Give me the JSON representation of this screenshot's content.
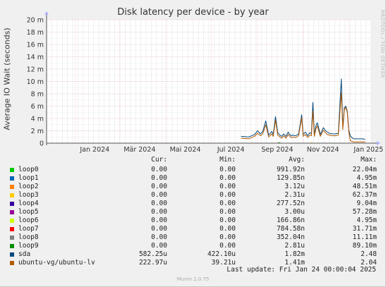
{
  "watermark": "RRDTOOL / TOBI OETIKER",
  "footer": "Munin 2.0.75",
  "last_update": "Last update: Fri Jan 24 00:00:04 2025",
  "legend_headers": {
    "cur": "Cur:",
    "min": "Min:",
    "avg": "Avg:",
    "max": "Max:"
  },
  "legend": [
    {
      "name": "loop0",
      "color": "#00cc00",
      "cur": "0.00",
      "min": "0.00",
      "avg": "991.92n",
      "max": "22.04m"
    },
    {
      "name": "loop1",
      "color": "#0066b3",
      "cur": "0.00",
      "min": "0.00",
      "avg": "129.85n",
      "max": "4.95m"
    },
    {
      "name": "loop2",
      "color": "#ff8000",
      "cur": "0.00",
      "min": "0.00",
      "avg": "3.12u",
      "max": "48.51m"
    },
    {
      "name": "loop3",
      "color": "#ffcc00",
      "cur": "0.00",
      "min": "0.00",
      "avg": "2.31u",
      "max": "62.37m"
    },
    {
      "name": "loop4",
      "color": "#330099",
      "cur": "0.00",
      "min": "0.00",
      "avg": "277.52n",
      "max": "9.04m"
    },
    {
      "name": "loop5",
      "color": "#990099",
      "cur": "0.00",
      "min": "0.00",
      "avg": "3.00u",
      "max": "57.28m"
    },
    {
      "name": "loop6",
      "color": "#ccff00",
      "cur": "0.00",
      "min": "0.00",
      "avg": "166.86n",
      "max": "4.95m"
    },
    {
      "name": "loop7",
      "color": "#ff0000",
      "cur": "0.00",
      "min": "0.00",
      "avg": "784.58n",
      "max": "31.71m"
    },
    {
      "name": "loop8",
      "color": "#808080",
      "cur": "0.00",
      "min": "0.00",
      "avg": "352.04n",
      "max": "11.11m"
    },
    {
      "name": "loop9",
      "color": "#008f00",
      "cur": "0.00",
      "min": "0.00",
      "avg": "2.81u",
      "max": "89.10m"
    },
    {
      "name": "sda",
      "color": "#00487d",
      "cur": "582.25u",
      "min": "422.10u",
      "avg": "1.82m",
      "max": "2.48"
    },
    {
      "name": "ubuntu-vg/ubuntu-lv",
      "color": "#b35a00",
      "cur": "222.97u",
      "min": "39.21u",
      "avg": "1.41m",
      "max": "2.04"
    }
  ],
  "chart_data": {
    "type": "line",
    "title": "Disk latency per device - by year",
    "ylabel": "Average IO Wait (seconds)",
    "y_unit": "m",
    "ylim": [
      0,
      20
    ],
    "y_ticks": [
      0,
      2,
      4,
      6,
      8,
      10,
      12,
      14,
      16,
      18,
      20
    ],
    "y_tick_labels": [
      "0",
      "2 m",
      "4 m",
      "6 m",
      "8 m",
      "10 m",
      "12 m",
      "14 m",
      "16 m",
      "18 m",
      "20 m"
    ],
    "xlim": [
      "2023-11-24",
      "2025-01-30"
    ],
    "x_ticks": [
      "2024-01-01",
      "2024-03-01",
      "2024-05-01",
      "2024-07-01",
      "2024-09-01",
      "2024-11-01",
      "2025-01-01"
    ],
    "x_tick_labels": [
      "Jan 2024",
      "Mär 2024",
      "Mai 2024",
      "Jul 2024",
      "Sep 2024",
      "Nov 2024",
      "Jan 2025"
    ],
    "grid": true,
    "series": [
      {
        "name": "sda",
        "color": "#00487d",
        "x": [
          "2024-08-10",
          "2024-08-20",
          "2024-08-28",
          "2024-09-01",
          "2024-09-05",
          "2024-09-08",
          "2024-09-12",
          "2024-09-16",
          "2024-09-20",
          "2024-09-22",
          "2024-09-25",
          "2024-09-28",
          "2024-10-01",
          "2024-10-03",
          "2024-10-06",
          "2024-10-09",
          "2024-10-12",
          "2024-10-14",
          "2024-10-16",
          "2024-10-18",
          "2024-10-22",
          "2024-10-26",
          "2024-10-30",
          "2024-11-01",
          "2024-11-04",
          "2024-11-07",
          "2024-11-10",
          "2024-11-12",
          "2024-11-14",
          "2024-11-16",
          "2024-11-18",
          "2024-11-20",
          "2024-11-24",
          "2024-11-28",
          "2024-12-02",
          "2024-12-06",
          "2024-12-10",
          "2024-12-14",
          "2024-12-18",
          "2024-12-22",
          "2024-12-24",
          "2024-12-26",
          "2024-12-28",
          "2024-12-30",
          "2025-01-01",
          "2025-01-03",
          "2025-01-05",
          "2025-01-08",
          "2025-01-12",
          "2025-01-16",
          "2025-01-20",
          "2025-01-23"
        ],
        "values": [
          1.1,
          1.0,
          1.4,
          2.0,
          1.5,
          1.9,
          3.6,
          1.3,
          1.9,
          1.4,
          4.3,
          1.7,
          1.3,
          1.1,
          1.5,
          1.1,
          1.8,
          1.4,
          1.2,
          1.3,
          1.2,
          1.5,
          4.6,
          1.4,
          1.8,
          1.2,
          1.7,
          1.5,
          6.6,
          1.4,
          2.8,
          3.3,
          1.4,
          2.5,
          1.9,
          1.6,
          1.5,
          1.5,
          1.6,
          10.4,
          2.6,
          5.7,
          6.0,
          5.2,
          2.1,
          1.2,
          0.9,
          0.7,
          0.7,
          0.7,
          0.7,
          0.6
        ]
      },
      {
        "name": "ubuntu-vg/ubuntu-lv",
        "color": "#b35a00",
        "x": [
          "2024-08-10",
          "2024-08-20",
          "2024-08-28",
          "2024-09-01",
          "2024-09-05",
          "2024-09-08",
          "2024-09-12",
          "2024-09-16",
          "2024-09-20",
          "2024-09-22",
          "2024-09-25",
          "2024-09-28",
          "2024-10-01",
          "2024-10-03",
          "2024-10-06",
          "2024-10-09",
          "2024-10-12",
          "2024-10-14",
          "2024-10-16",
          "2024-10-18",
          "2024-10-22",
          "2024-10-26",
          "2024-10-30",
          "2024-11-01",
          "2024-11-04",
          "2024-11-07",
          "2024-11-10",
          "2024-11-12",
          "2024-11-14",
          "2024-11-16",
          "2024-11-18",
          "2024-11-20",
          "2024-11-24",
          "2024-11-28",
          "2024-12-02",
          "2024-12-06",
          "2024-12-10",
          "2024-12-14",
          "2024-12-18",
          "2024-12-22",
          "2024-12-24",
          "2024-12-26",
          "2024-12-28",
          "2024-12-30",
          "2025-01-01",
          "2025-01-03",
          "2025-01-05",
          "2025-01-08",
          "2025-01-12",
          "2025-01-16",
          "2025-01-20",
          "2025-01-23"
        ],
        "values": [
          0.8,
          0.7,
          1.1,
          1.6,
          1.2,
          1.5,
          3.0,
          1.0,
          1.5,
          1.1,
          3.7,
          1.3,
          1.0,
          0.8,
          1.2,
          0.8,
          1.4,
          1.1,
          0.9,
          1.0,
          0.9,
          1.2,
          4.1,
          1.1,
          1.4,
          0.9,
          1.3,
          1.2,
          5.2,
          1.1,
          2.3,
          2.8,
          1.1,
          2.1,
          1.5,
          1.3,
          1.2,
          1.2,
          1.3,
          8.2,
          2.2,
          5.4,
          5.8,
          5.0,
          1.8,
          0.4,
          0.3,
          0.2,
          0.2,
          0.2,
          0.2,
          0.2
        ]
      },
      {
        "name": "loop9",
        "color": "#008f00",
        "x": [
          "2024-09-28",
          "2024-09-30",
          "2024-10-02"
        ],
        "values": [
          0,
          0.09,
          0
        ]
      },
      {
        "name": "loop3",
        "color": "#ffcc00",
        "x": [
          "2024-11-10",
          "2024-11-12",
          "2024-11-14"
        ],
        "values": [
          0,
          0.06,
          0
        ]
      }
    ]
  }
}
